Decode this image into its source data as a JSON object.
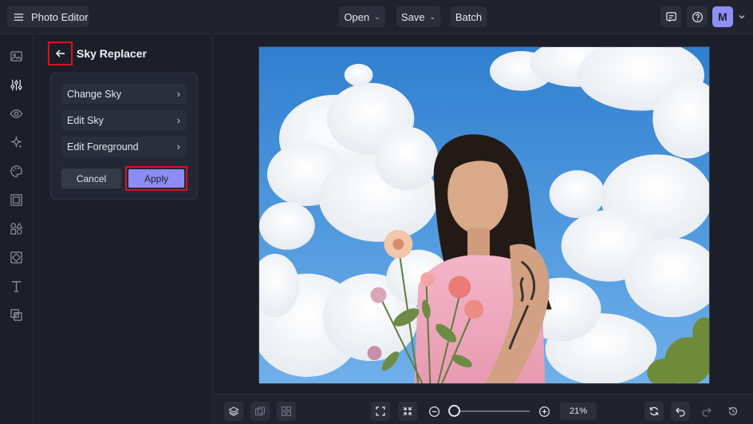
{
  "app": {
    "title": "Photo Editor"
  },
  "topbar": {
    "open_label": "Open",
    "save_label": "Save",
    "batch_label": "Batch",
    "avatar_letter": "M"
  },
  "rail": {
    "icons": [
      "image-icon",
      "sliders-icon",
      "eye-icon",
      "sparkle-icon",
      "palette-icon",
      "frame-icon",
      "shapes-icon",
      "crop-square-icon",
      "text-icon",
      "overlay-icon"
    ]
  },
  "panel": {
    "title": "Sky Replacer",
    "items": [
      {
        "label": "Change Sky"
      },
      {
        "label": "Edit Sky"
      },
      {
        "label": "Edit Foreground"
      }
    ],
    "cancel_label": "Cancel",
    "apply_label": "Apply"
  },
  "zoom": {
    "value": "21%"
  },
  "colors": {
    "accent": "#8c8cf4",
    "highlight": "#d3151e",
    "background": "#1c1f29"
  }
}
